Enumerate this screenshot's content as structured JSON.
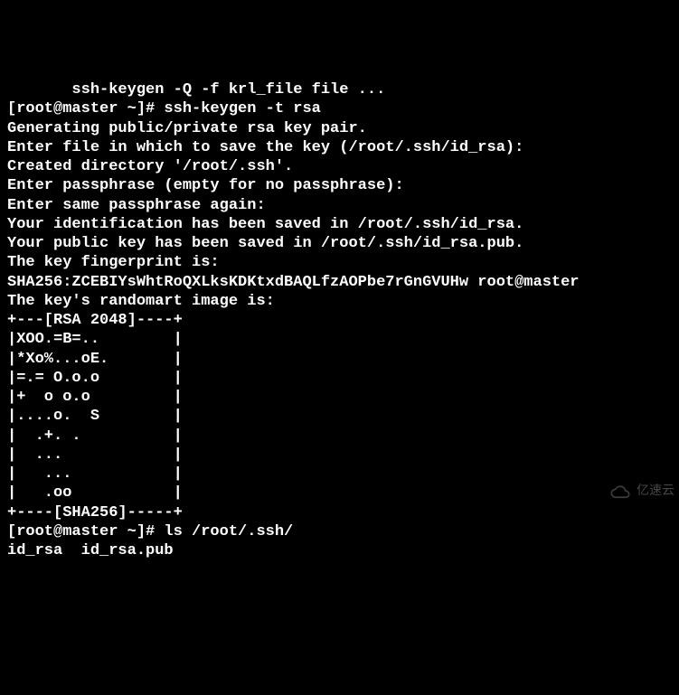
{
  "lines": [
    "       ssh-keygen -Q -f krl_file file ...",
    "[root@master ~]# ssh-keygen -t rsa",
    "Generating public/private rsa key pair.",
    "Enter file in which to save the key (/root/.ssh/id_rsa):",
    "Created directory '/root/.ssh'.",
    "Enter passphrase (empty for no passphrase):",
    "Enter same passphrase again:",
    "Your identification has been saved in /root/.ssh/id_rsa.",
    "Your public key has been saved in /root/.ssh/id_rsa.pub.",
    "The key fingerprint is:",
    "SHA256:ZCEBIYsWhtRoQXLksKDKtxdBAQLfzAOPbe7rGnGVUHw root@master",
    "The key's randomart image is:",
    "+---[RSA 2048]----+",
    "|XOO.=B=..        |",
    "|*Xo%...oE.       |",
    "|=.= O.o.o        |",
    "|+  o o.o         |",
    "|....o.  S        |",
    "|  .+. .          |",
    "|  ...            |",
    "|   ...           |",
    "|   .oo           |",
    "+----[SHA256]-----+",
    "[root@master ~]# ls /root/.ssh/",
    "id_rsa  id_rsa.pub"
  ],
  "watermark": "亿速云"
}
